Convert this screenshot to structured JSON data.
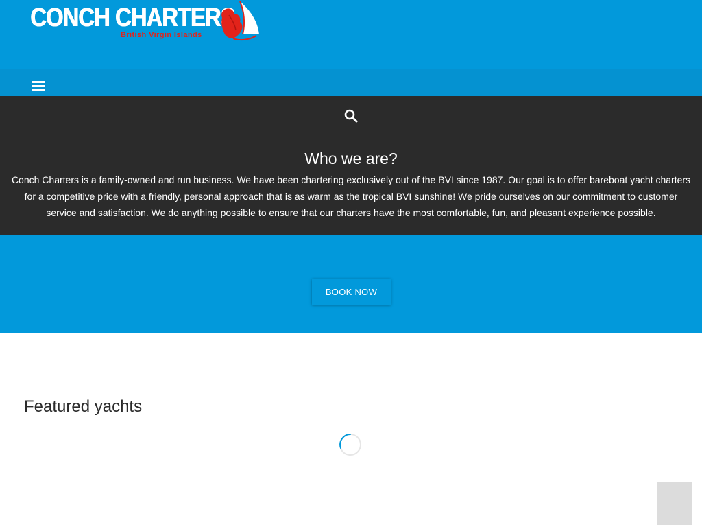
{
  "header": {
    "logo_title": "CONCH CHARTERS",
    "logo_subtitle": "British Virgin Islands"
  },
  "navbar": {
    "menu_icon": "hamburger-menu-icon"
  },
  "about": {
    "search_icon": "search-icon",
    "title": "Who we are?",
    "text": "Conch Charters is a family-owned and run business. We have been chartering exclusively out of the BVI since 1987. Our goal is to offer bareboat yacht charters for a competitive price with a friendly, personal approach that is as warm as the tropical BVI sunshine! We pride ourselves on our commitment to customer service and satisfaction. We do anything possible to ensure that our charters have the most comfortable, fun, and pleasant experience possible."
  },
  "cta": {
    "book_label": "BOOK NOW"
  },
  "featured": {
    "title": "Featured yachts",
    "loading_icon": "loading-spinner-icon"
  },
  "colors": {
    "header_blue": "#0299db",
    "navbar_blue": "#0592d1",
    "about_dark": "#2b2b2b",
    "logo_red": "#e2231a",
    "scroll_top_gray": "#dcdcdc"
  }
}
